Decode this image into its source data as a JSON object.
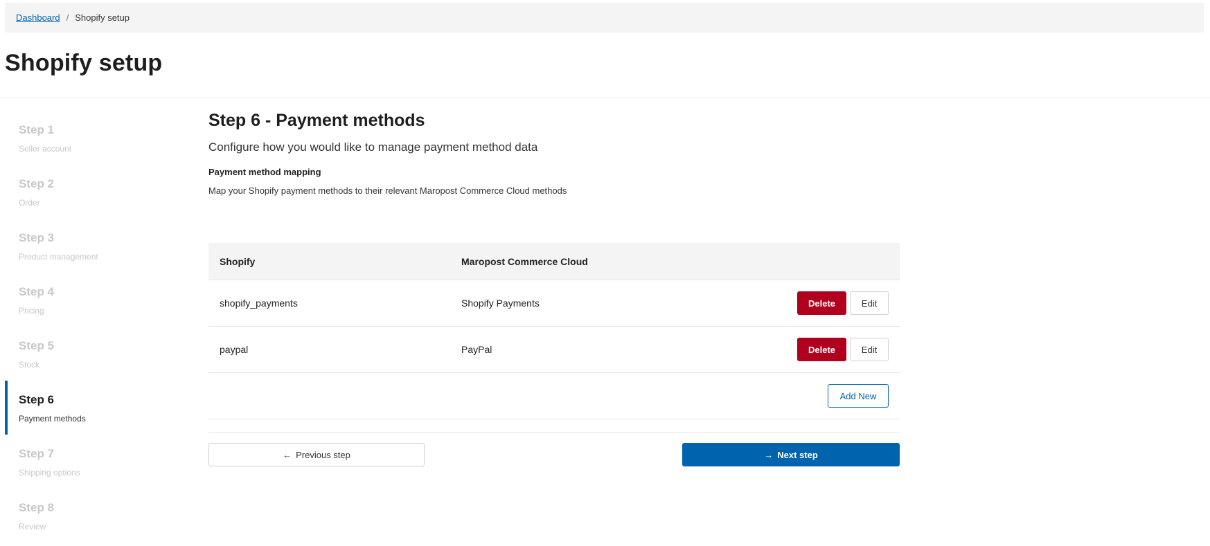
{
  "breadcrumb": {
    "home": "Dashboard",
    "separator": "/",
    "current": "Shopify setup"
  },
  "page": {
    "title": "Shopify setup"
  },
  "steps": [
    {
      "title": "Step 1",
      "subtitle": "Seller account",
      "active": false
    },
    {
      "title": "Step 2",
      "subtitle": "Order",
      "active": false
    },
    {
      "title": "Step 3",
      "subtitle": "Product management",
      "active": false
    },
    {
      "title": "Step 4",
      "subtitle": "Pricing",
      "active": false
    },
    {
      "title": "Step 5",
      "subtitle": "Stock",
      "active": false
    },
    {
      "title": "Step 6",
      "subtitle": "Payment methods",
      "active": true
    },
    {
      "title": "Step 7",
      "subtitle": "Shipping options",
      "active": false
    },
    {
      "title": "Step 8",
      "subtitle": "Review",
      "active": false
    }
  ],
  "section": {
    "title": "Step 6 - Payment methods",
    "description": "Configure how you would like to manage payment method data",
    "mapping_label": "Payment method mapping",
    "mapping_description": "Map your Shopify payment methods to their relevant Maropost Commerce Cloud methods"
  },
  "table": {
    "headers": [
      "Shopify",
      "Maropost Commerce Cloud"
    ],
    "rows": [
      {
        "shopify": "shopify_payments",
        "maropost": "Shopify Payments"
      },
      {
        "shopify": "paypal",
        "maropost": "PayPal"
      }
    ],
    "delete_label": "Delete",
    "edit_label": "Edit",
    "add_label": "Add New"
  },
  "nav": {
    "prev_label": "Previous step",
    "next_label": "Next step",
    "prev_icon": "arrow-left-icon",
    "next_icon": "arrow-right-icon"
  },
  "colors": {
    "primary": "#0063ae",
    "danger": "#b0001e",
    "muted": "#c8c8c8"
  }
}
